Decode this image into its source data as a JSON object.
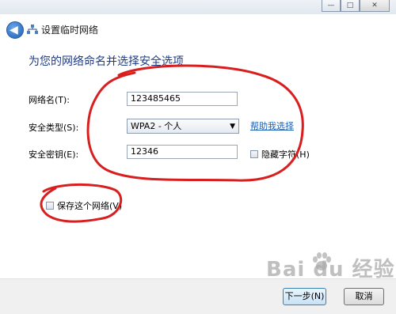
{
  "window": {
    "minimize_glyph": "—",
    "maximize_glyph": "□",
    "close_glyph": "✕"
  },
  "header": {
    "back_glyph": "◀",
    "network_icon": "network-icon",
    "title": "设置临时网络"
  },
  "main": {
    "heading": "为您的网络命名并选择安全选项",
    "network_name": {
      "label": "网络名(T):",
      "value": "123485465"
    },
    "security_type": {
      "label": "安全类型(S):",
      "value": "WPA2 - 个人",
      "arrow": "▼"
    },
    "help_link": "帮助我选择",
    "security_key": {
      "label": "安全密钥(E):",
      "value": "12346"
    },
    "hide_chars": "隐藏字符(H)",
    "save_network": "保存这个网络(V)"
  },
  "footer": {
    "next_label": "下一步(N)",
    "cancel_label": "取消"
  },
  "watermark": {
    "text": "Bai du 经验"
  },
  "colors": {
    "annotation": "#d81e1e",
    "heading": "#1e3b86",
    "link": "#1a5fb4"
  }
}
